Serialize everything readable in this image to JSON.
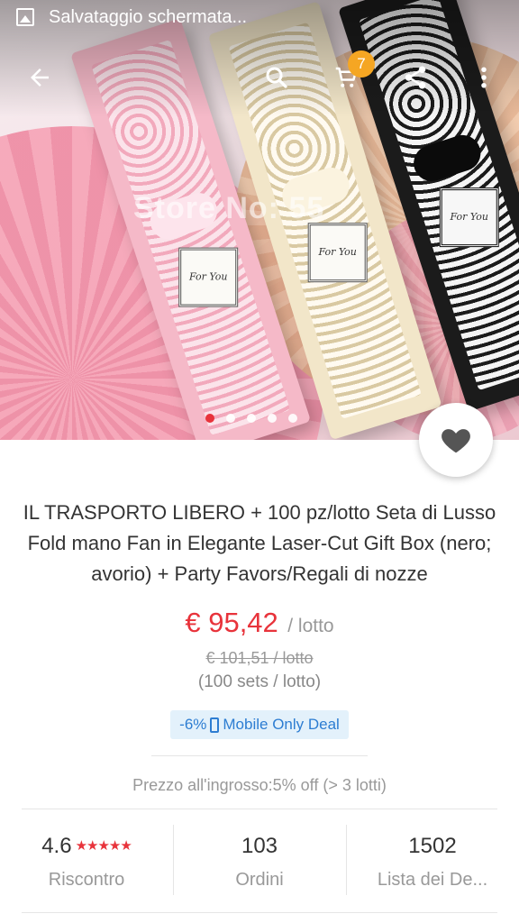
{
  "statusbar": {
    "notification": "Salvataggio schermata..."
  },
  "toolbar": {
    "cart_count": "7"
  },
  "hero": {
    "watermark": "Store No:   55",
    "tag_text": "For You",
    "carousel_dots": [
      true,
      false,
      false,
      false,
      false
    ]
  },
  "product": {
    "title": "IL TRASPORTO LIBERO + 100 pz/lotto Seta di Lusso Fold mano Fan in Elegante Laser-Cut Gift Box (nero; avorio) + Party Favors/Regali di nozze",
    "price": "€ 95,42",
    "price_unit": "/ lotto",
    "old_price": "€ 101,51 / lotto",
    "sets": "(100 sets / lotto)",
    "deal": {
      "discount": "-6%",
      "label": "Mobile Only Deal"
    },
    "wholesale": "Prezzo all'ingrosso:5% off (> 3 lotti)"
  },
  "stats": [
    {
      "value": "4.6",
      "label": "Riscontro",
      "stars": "★★★★★"
    },
    {
      "value": "103",
      "label": "Ordini"
    },
    {
      "value": "1502",
      "label": "Lista dei De..."
    }
  ],
  "colors": {
    "accent": "#e8333b",
    "badge": "#f5a623",
    "deal_bg": "#e3f1fb",
    "deal_text": "#2d7dd2"
  }
}
